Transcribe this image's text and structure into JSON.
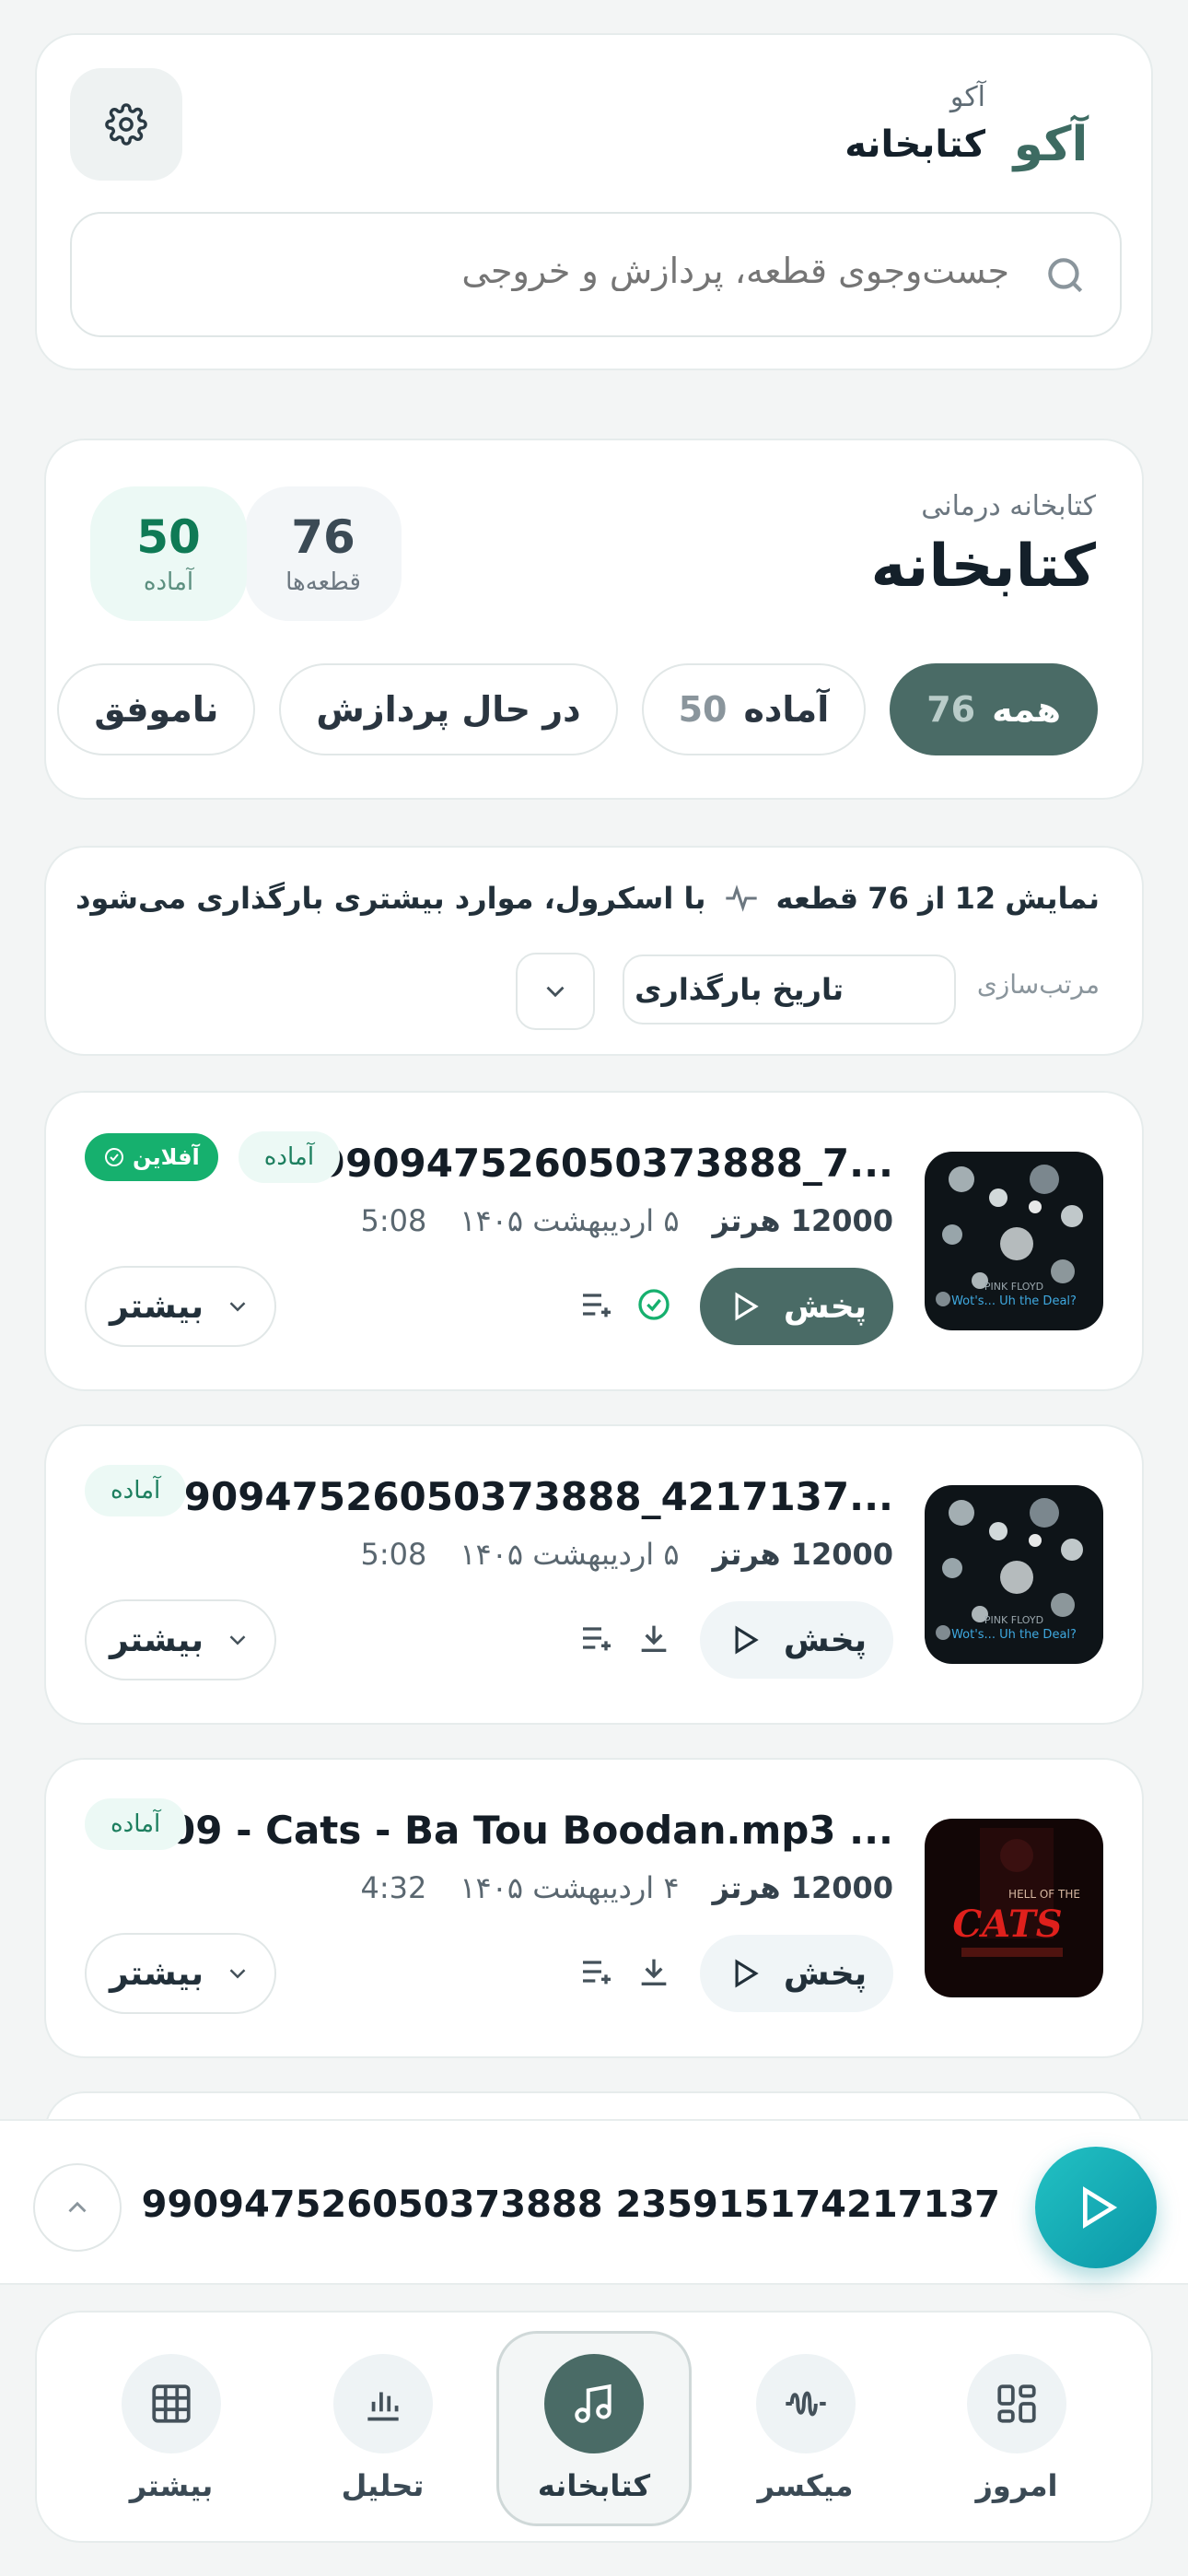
{
  "header": {
    "app_name": "آکو",
    "page_name": "کتابخانه",
    "logo_text": "آکو",
    "search_placeholder": "جست‌وجوی قطعه، پردازش و خروجی"
  },
  "summary": {
    "eyebrow": "کتابخانه درمانی",
    "title": "کتابخانه",
    "stats": [
      {
        "value": "76",
        "label": "قطعه‌ها"
      },
      {
        "value": "50",
        "label": "آماده"
      }
    ],
    "filters": [
      {
        "label": "همه",
        "count": "76",
        "active": true
      },
      {
        "label": "آماده",
        "count": "50",
        "active": false
      },
      {
        "label": "در حال پردازش",
        "count": "",
        "active": false
      },
      {
        "label": "ناموفق",
        "count": "",
        "active": false
      }
    ]
  },
  "infobar": {
    "showing_prefix": "نمایش",
    "shown": "12",
    "of": "از",
    "total": "76",
    "unit": "قطعه",
    "scroll_note": "با اسکرول، موارد بیشتری بارگذاری می‌شود",
    "sort_label": "مرتب‌سازی",
    "sort_value": "تاریخ بارگذاری"
  },
  "tracks": [
    {
      "title": "-990947526050373888_7...",
      "duration": "5:08",
      "date": "۵ اردیبهشت ۱۴۰۵",
      "rate_value": "12000",
      "rate_unit": "هرتز",
      "status": "آماده",
      "offline": "آفلاین",
      "play_label": "پخش",
      "more_label": "بیشتر",
      "cover_caption": "Wot's... Uh the Deal?"
    },
    {
      "title": "-990947526050373888_4217137...",
      "duration": "5:08",
      "date": "۵ اردیبهشت ۱۴۰۵",
      "rate_value": "12000",
      "rate_unit": "هرتز",
      "status": "آماده",
      "play_label": "پخش",
      "more_label": "بیشتر",
      "cover_caption": "Wot's... Uh the Deal?"
    },
    {
      "title": "09 - Cats - Ba Tou Boodan.mp3 ...",
      "duration": "4:32",
      "date": "۴ اردیبهشت ۱۴۰۵",
      "rate_value": "12000",
      "rate_unit": "هرتز",
      "status": "آماده",
      "play_label": "پخش",
      "more_label": "بیشتر",
      "cover_caption": "CATS"
    }
  ],
  "mini_player": {
    "title": "990947526050373888 235915174217137"
  },
  "bottom_nav": [
    {
      "label": "امروز",
      "icon": "dashboard-icon",
      "active": false
    },
    {
      "label": "میکسر",
      "icon": "waveform-icon",
      "active": false
    },
    {
      "label": "کتابخانه",
      "icon": "music-note-icon",
      "active": true
    },
    {
      "label": "تحلیل",
      "icon": "bar-chart-icon",
      "active": false
    },
    {
      "label": "بیشتر",
      "icon": "grid-icon",
      "active": false
    }
  ],
  "colors": {
    "accent": "#4a6b66",
    "ready_bg": "#ecf9f5",
    "offline": "#16b06e",
    "player": "#0b97a8"
  }
}
